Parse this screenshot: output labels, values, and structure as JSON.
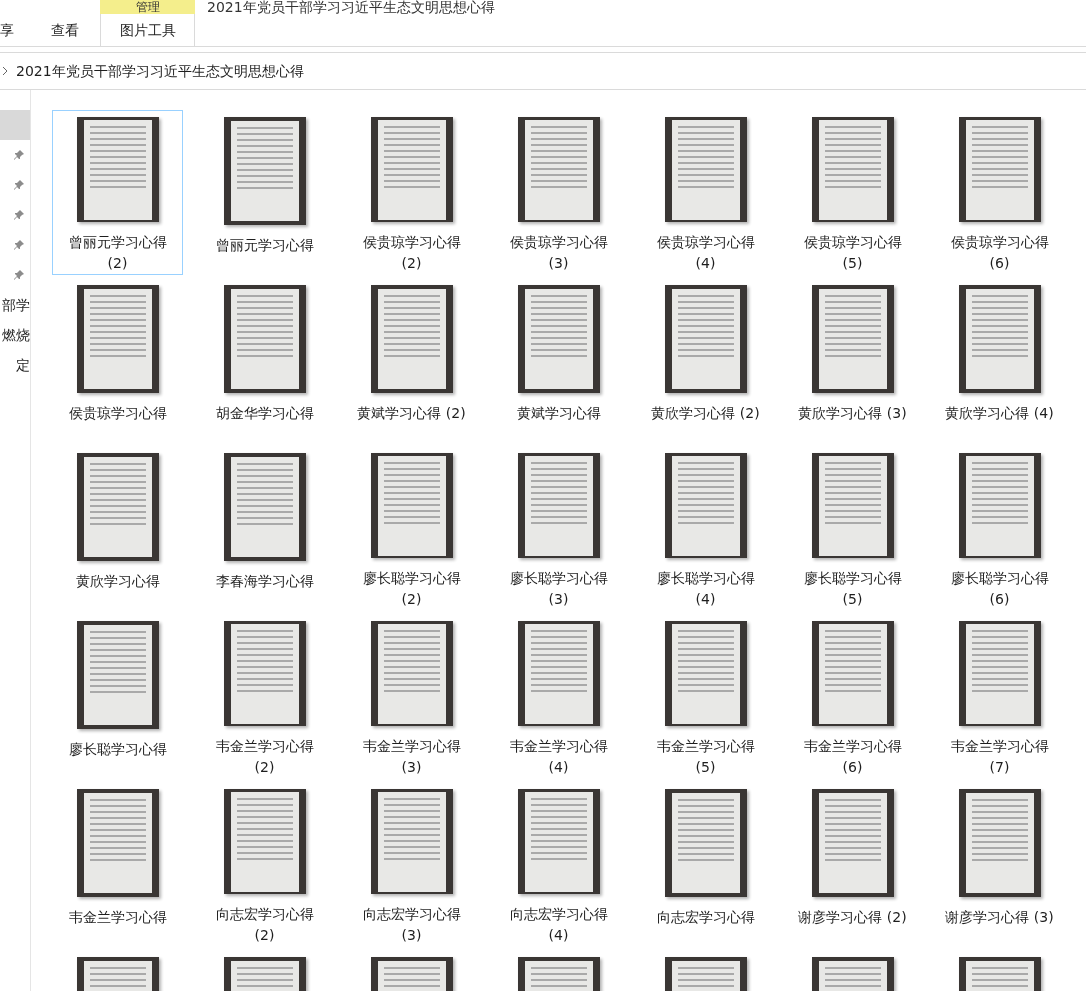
{
  "ribbon": {
    "context_tab": "管理",
    "window_title": "2021年党员干部学习习近平生态文明思想心得",
    "tabs": [
      {
        "label": "享",
        "selected": false
      },
      {
        "label": "查看",
        "selected": false
      },
      {
        "label": "图片工具",
        "selected": true
      }
    ]
  },
  "address_bar": {
    "path": "2021年党员干部学习习近平生态文明思想心得"
  },
  "sidebar": {
    "items": [
      {
        "kind": "blank",
        "selected": true
      },
      {
        "kind": "pinned",
        "selected": false
      },
      {
        "kind": "pinned",
        "selected": false
      },
      {
        "kind": "pinned",
        "selected": false
      },
      {
        "kind": "pinned",
        "selected": false
      },
      {
        "kind": "pinned",
        "selected": false
      },
      {
        "kind": "text",
        "label": "部学",
        "selected": false
      },
      {
        "kind": "text",
        "label": "燃烧",
        "selected": false
      },
      {
        "kind": "text",
        "label": "定",
        "selected": false
      }
    ]
  },
  "files": [
    {
      "name": "曾丽元学习心得 (2)",
      "selected": true
    },
    {
      "name": "曾丽元学习心得",
      "selected": false
    },
    {
      "name": "侯贵琼学习心得 (2)",
      "selected": false
    },
    {
      "name": "侯贵琼学习心得 (3)",
      "selected": false
    },
    {
      "name": "侯贵琼学习心得 (4)",
      "selected": false
    },
    {
      "name": "侯贵琼学习心得 (5)",
      "selected": false
    },
    {
      "name": "侯贵琼学习心得 (6)",
      "selected": false
    },
    {
      "name": "侯贵琼学习心得",
      "selected": false
    },
    {
      "name": "胡金华学习心得",
      "selected": false
    },
    {
      "name": "黄斌学习心得 (2)",
      "selected": false
    },
    {
      "name": "黄斌学习心得",
      "selected": false
    },
    {
      "name": "黄欣学习心得 (2)",
      "selected": false
    },
    {
      "name": "黄欣学习心得 (3)",
      "selected": false
    },
    {
      "name": "黄欣学习心得 (4)",
      "selected": false
    },
    {
      "name": "黄欣学习心得",
      "selected": false
    },
    {
      "name": "李春海学习心得",
      "selected": false
    },
    {
      "name": "廖长聪学习心得 (2)",
      "selected": false
    },
    {
      "name": "廖长聪学习心得 (3)",
      "selected": false
    },
    {
      "name": "廖长聪学习心得 (4)",
      "selected": false
    },
    {
      "name": "廖长聪学习心得 (5)",
      "selected": false
    },
    {
      "name": "廖长聪学习心得 (6)",
      "selected": false
    },
    {
      "name": "廖长聪学习心得",
      "selected": false
    },
    {
      "name": "韦金兰学习心得 (2)",
      "selected": false
    },
    {
      "name": "韦金兰学习心得 (3)",
      "selected": false
    },
    {
      "name": "韦金兰学习心得 (4)",
      "selected": false
    },
    {
      "name": "韦金兰学习心得 (5)",
      "selected": false
    },
    {
      "name": "韦金兰学习心得 (6)",
      "selected": false
    },
    {
      "name": "韦金兰学习心得 (7)",
      "selected": false
    },
    {
      "name": "韦金兰学习心得",
      "selected": false
    },
    {
      "name": "向志宏学习心得 (2)",
      "selected": false
    },
    {
      "name": "向志宏学习心得 (3)",
      "selected": false
    },
    {
      "name": "向志宏学习心得 (4)",
      "selected": false
    },
    {
      "name": "向志宏学习心得",
      "selected": false
    },
    {
      "name": "谢彦学习心得 (2)",
      "selected": false
    },
    {
      "name": "谢彦学习心得 (3)",
      "selected": false
    },
    {
      "selected": false
    },
    {
      "selected": false
    },
    {
      "selected": false
    },
    {
      "selected": false
    },
    {
      "selected": false
    },
    {
      "selected": false
    },
    {
      "selected": false
    }
  ]
}
